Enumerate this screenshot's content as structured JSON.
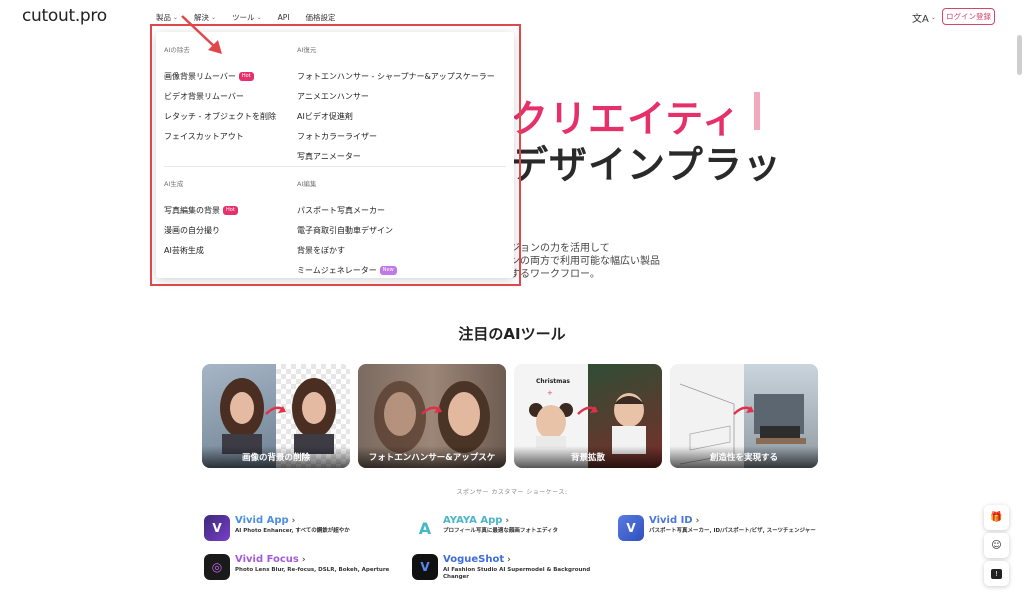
{
  "header": {
    "logo": "cutout.pro",
    "nav": [
      {
        "label": "製品"
      },
      {
        "label": "解決"
      },
      {
        "label": "ツール"
      },
      {
        "label": "API"
      },
      {
        "label": "価格設定"
      }
    ],
    "login_label": "ログイン登録",
    "lang_icon": "translate-icon"
  },
  "hero": {
    "line1": "クリエイティ",
    "line2": "デザインプラッ",
    "desc_line1": "ジョンの力を活用して",
    "desc_line2": "ンの両方で利用可能な幅広い製品",
    "desc_line3": "するワークフロー。"
  },
  "dropdown": {
    "top_left": {
      "title": "AIの除去",
      "items": [
        {
          "label": "画像背景リムーバー",
          "badge": "Hot"
        },
        {
          "label": "ビデオ背景リムーバー"
        },
        {
          "label": "レタッチ - オブジェクトを削除"
        },
        {
          "label": "フェイスカットアウト"
        }
      ]
    },
    "top_right": {
      "title": "AI復元",
      "items": [
        {
          "label": "フォトエンハンサー - シャープナー&アップスケーラー"
        },
        {
          "label": "アニメエンハンサー"
        },
        {
          "label": "AIビデオ促進剤"
        },
        {
          "label": "フォトカラーライザー"
        },
        {
          "label": "写真アニメーター"
        }
      ]
    },
    "bottom_left": {
      "title": "AI生成",
      "items": [
        {
          "label": "写真編集の背景",
          "badge": "Hot"
        },
        {
          "label": "漫画の自分撮り"
        },
        {
          "label": "AI芸術生成"
        }
      ]
    },
    "bottom_right": {
      "title": "AI編集",
      "items": [
        {
          "label": "パスポート写真メーカー"
        },
        {
          "label": "電子商取引自動車デザイン"
        },
        {
          "label": "背景をぼかす"
        },
        {
          "label": "ミームジェネレーター",
          "badge": "New"
        }
      ]
    }
  },
  "featured": {
    "title": "注目のAIツール",
    "cards": [
      {
        "label": "画像の背景の削除"
      },
      {
        "label": "フォトエンハンサー&アップスケ"
      },
      {
        "label": "背景拡散",
        "caption": "Christmas"
      },
      {
        "label": "創造性を実現する"
      }
    ]
  },
  "showcase": {
    "title": "スポンサー カスタマー ショーケース:",
    "apps": [
      {
        "name": "Vivid App",
        "desc": "AI Photo Enhancer, すべての鋼鉄が超やか",
        "color": "#4a8fe0"
      },
      {
        "name": "AYAYA App",
        "desc": "プロフィール写真に最適な顔画フォトエディタ",
        "color": "#49b6c9"
      },
      {
        "name": "Vivid ID",
        "desc": "パスポート写真メーカー, ID/パスポート/ビザ, スーツチェンジャー",
        "color": "#4a78d8"
      },
      {
        "name": "Vivid Focus",
        "desc": "Photo Lens Blur, Re-focus, DSLR, Bokeh, Aperture",
        "color": "#a45bd8"
      },
      {
        "name": "VogueShot",
        "desc": "AI Fashion Studio AI Supermodel & Background Changer",
        "color": "#3d6ddc"
      }
    ]
  },
  "colors": {
    "accent": "#e6306a",
    "highlight_border": "#e0474c"
  }
}
